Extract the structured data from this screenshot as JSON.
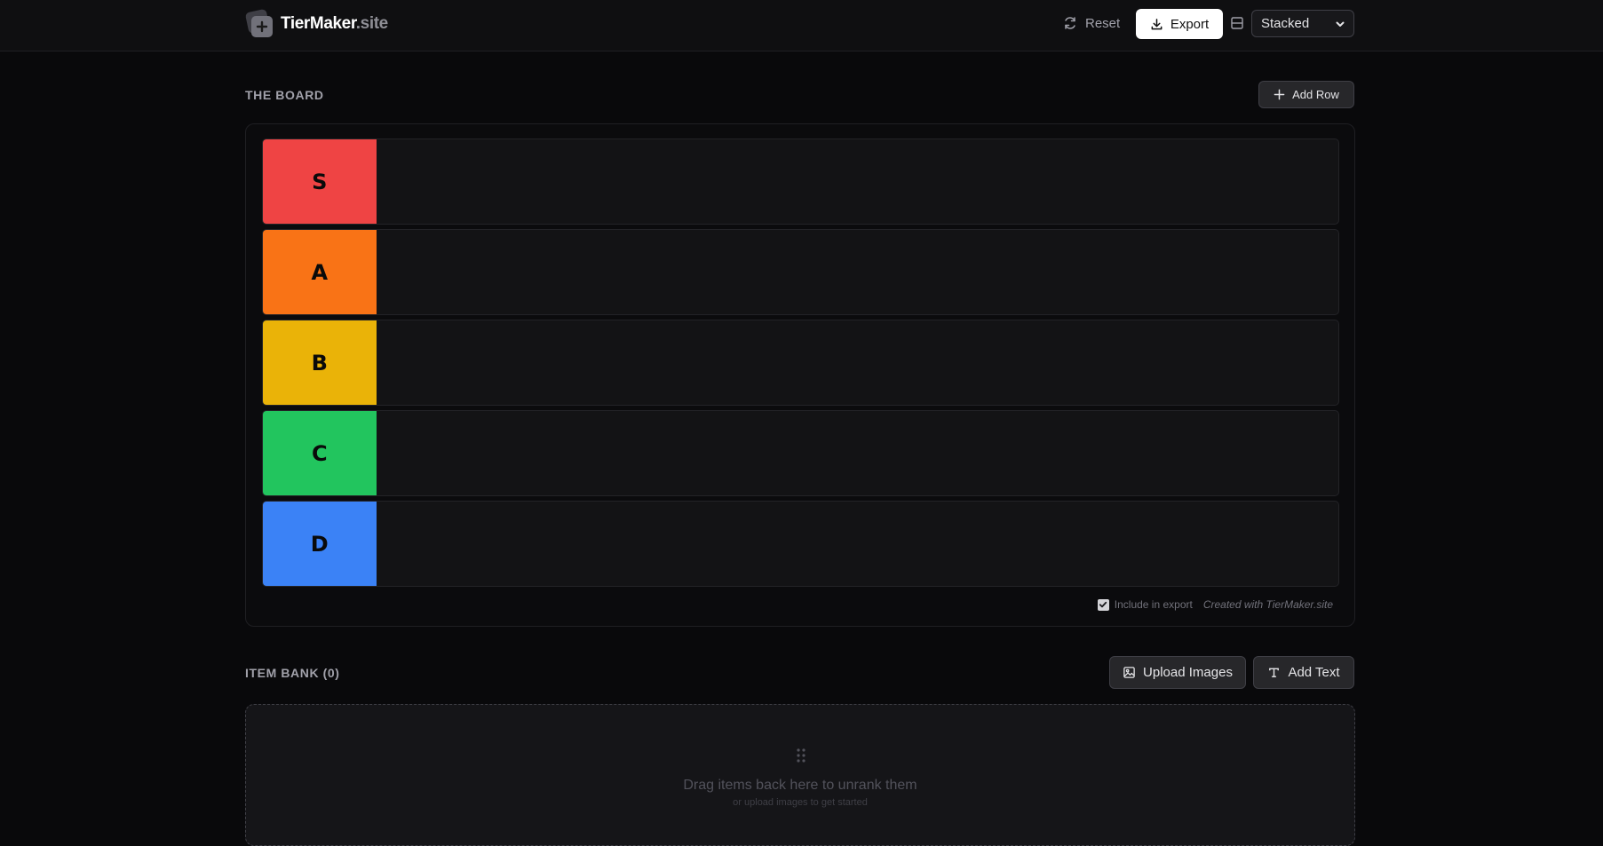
{
  "header": {
    "logo_main": "TierMaker",
    "logo_suffix": ".site",
    "reset_label": "Reset",
    "export_label": "Export",
    "layout_selected": "Stacked"
  },
  "board": {
    "title": "THE BOARD",
    "add_row_label": "Add Row",
    "tiers": [
      {
        "label": "S",
        "color": "#ef4444"
      },
      {
        "label": "A",
        "color": "#f97316"
      },
      {
        "label": "B",
        "color": "#eab308"
      },
      {
        "label": "C",
        "color": "#22c55e"
      },
      {
        "label": "D",
        "color": "#3b82f6"
      }
    ],
    "include_export_label": "Include in export",
    "include_export_checked": true,
    "credit_text": "Created with TierMaker.site"
  },
  "item_bank": {
    "title": "ITEM BANK (0)",
    "upload_label": "Upload Images",
    "add_text_label": "Add Text",
    "empty_text": "Drag items back here to unrank them",
    "empty_subtext": "or upload images to get started"
  },
  "icons": {
    "logo": "logo-stack-plus-icon",
    "reset": "refresh-icon",
    "export": "download-icon",
    "layout": "layout-stacked-icon",
    "add_row": "plus-icon",
    "upload": "image-icon",
    "add_text": "text-icon",
    "bank": "drag-grip-icon"
  }
}
